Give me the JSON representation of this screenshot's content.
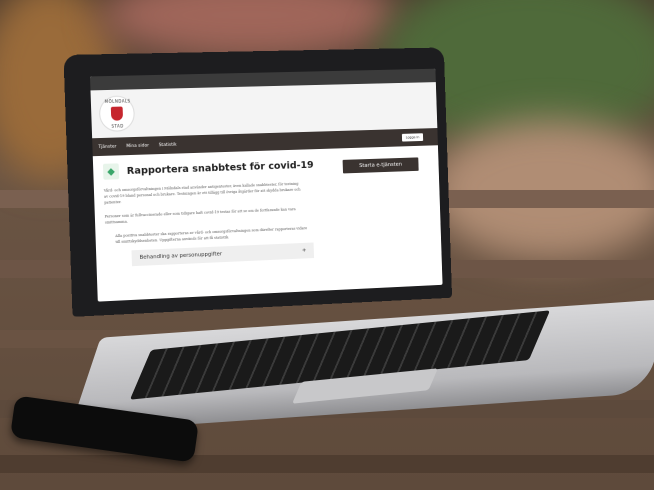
{
  "site": {
    "logo_text_top": "MÖLNDALS",
    "logo_text_bottom": "STAD",
    "nav": [
      "Tjänster",
      "Mina sidor",
      "Statistik"
    ],
    "login_label": "Logga in"
  },
  "page": {
    "title": "Rapportera snabbtest för covid-19",
    "start_button": "Starta e-tjänsten",
    "paragraphs": [
      "Vård- och omsorgsförvaltningen i Mölndals stad använder antigentester, även kallade snabbtester, för testning av covid-19 bland personal och brukare. Testningen är ett tillägg till övriga åtgärder för att skydda brukare och patienter.",
      "Personer som är fullvaccinerade eller som tidigare haft covid-19 testas för att se om de fortfarande kan vara smittsamma.",
      "Alla positiva snabbtester ska rapporteras av vård- och omsorgsförvaltningen som därefter rapporteras vidare till smittskyddsenheten. Uppgifterna används för att få statistik."
    ],
    "accordion_label": "Behandling av personuppgifter",
    "accordion_icon": "+"
  }
}
